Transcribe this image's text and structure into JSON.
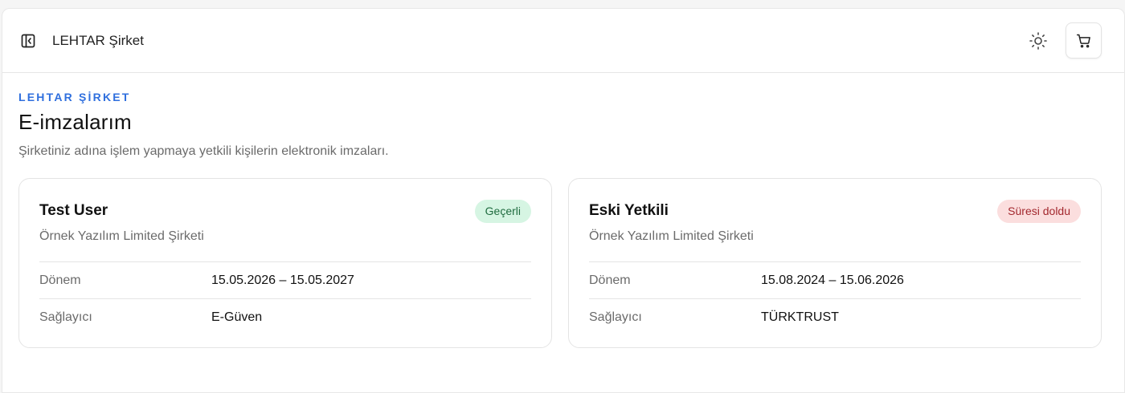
{
  "header": {
    "brand": "LEHTAR Şirket",
    "icons": {
      "sidebar_toggle": "sidebar-collapse-icon",
      "theme": "sun-icon",
      "cart": "cart-icon"
    }
  },
  "page": {
    "eyebrow": "LEHTAR ŞİRKET",
    "title": "E-imzalarım",
    "description": "Şirketiniz adına işlem yapmaya yetkili kişilerin elektronik imzaları."
  },
  "cards": [
    {
      "name": "Test User",
      "company": "Örnek Yazılım Limited Şirketi",
      "status": "Geçerli",
      "status_color": "#d6f5e3",
      "rows": [
        {
          "label": "Dönem",
          "value": "15.05.2026 – 15.05.2027"
        },
        {
          "label": "Sağlayıcı",
          "value": "E-Güven"
        }
      ]
    },
    {
      "name": "Eski Yetkili",
      "company": "Örnek Yazılım Limited Şirketi",
      "status": "Süresi doldu",
      "status_color": "#fbdede",
      "rows": [
        {
          "label": "Dönem",
          "value": "15.08.2024 – 15.06.2026"
        },
        {
          "label": "Sağlayıcı",
          "value": "TÜRKTRUST"
        }
      ]
    }
  ],
  "colors": {
    "accent": "#2f6fde",
    "muted_text": "#6b6b6b",
    "border": "#e4e4e4"
  }
}
